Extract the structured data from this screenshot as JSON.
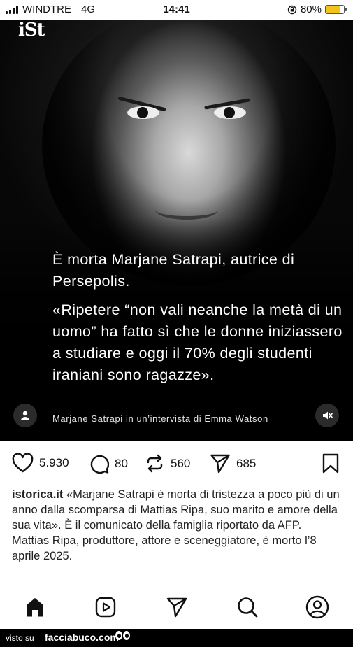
{
  "status_bar": {
    "carrier": "WINDTRE",
    "network": "4G",
    "time": "14:41",
    "battery_percent": "80%",
    "battery_level": 0.8,
    "icons": [
      "signal-icon",
      "orientation-lock-icon",
      "battery-icon"
    ]
  },
  "post": {
    "logo": "iSt",
    "headline": "È morta Marjane Satrapi, autrice di Persepolis.",
    "quote": "«Ripetere “non vali neanche la metà di un uomo” ha fatto sì che le donne iniziassero a studiare e oggi il 70% degli studenti iraniani sono ragazze».",
    "credit": "Marjane Satrapi in un’intervista di Emma Watson"
  },
  "actions": {
    "likes": "5.930",
    "comments": "80",
    "reposts": "560",
    "shares": "685"
  },
  "caption": {
    "username": "istorica.it",
    "text": "«Marjane Satrapi è morta di tristezza a poco più di un anno dalla scomparsa di Mattias Ripa, suo marito e amore della sua vita». È il comunicato della famiglia riportato da AFP. Mattias Ripa, produttore, attore e sceneggiatore, è morto l’8 aprile 2025."
  },
  "tabbar": {
    "icons": [
      "home-icon",
      "reels-icon",
      "messages-icon",
      "search-icon",
      "profile-icon"
    ]
  },
  "watermark": {
    "prefix": "visto su",
    "site": "facciabuco.com"
  }
}
